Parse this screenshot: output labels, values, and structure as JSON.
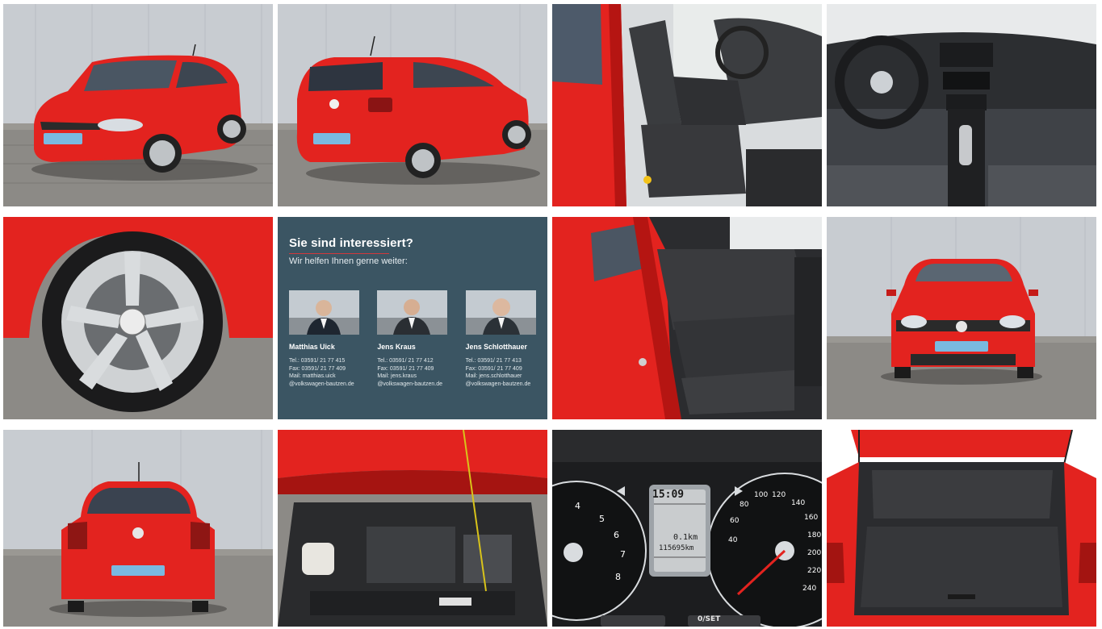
{
  "gallery": {
    "tiles": [
      {
        "id": "front-left-exterior"
      },
      {
        "id": "rear-right-exterior"
      },
      {
        "id": "front-seats-interior"
      },
      {
        "id": "dashboard-interior"
      },
      {
        "id": "wheel-rim"
      },
      {
        "id": "contact-card"
      },
      {
        "id": "rear-seats-interior"
      },
      {
        "id": "front-exterior"
      },
      {
        "id": "rear-exterior"
      },
      {
        "id": "engine-bay"
      },
      {
        "id": "instrument-cluster"
      },
      {
        "id": "trunk"
      }
    ]
  },
  "contact": {
    "title": "Sie sind interessiert?",
    "subtitle": "Wir helfen Ihnen gerne weiter:",
    "people": [
      {
        "name": "Matthias Uick",
        "tel": "Tel.:  03591/ 21 77 415",
        "fax": "Fax:  03591/ 21 77 409",
        "mail": "Mail:  matthias.uick",
        "domain": "@volkswagen-bautzen.de"
      },
      {
        "name": "Jens Kraus",
        "tel": "Tel.:   03591/ 21 77 412",
        "fax": "Fax:   03591/ 21 77 409",
        "mail": "Mail:   jens.kraus",
        "domain": "@volkswagen-bautzen.de"
      },
      {
        "name": "Jens Schlotthauer",
        "tel": "Tel.:  03591/ 21 77 413",
        "fax": "Fax:  03591/ 21 77 409",
        "mail": "Mail: jens.schlotthauer",
        "domain": "@volkswagen-bautzen.de"
      }
    ]
  },
  "cluster": {
    "clock": "15:09",
    "trip": "0.1km",
    "odometer": "115695km",
    "speed_ticks": [
      "40",
      "60",
      "80",
      "100",
      "120",
      "140",
      "160",
      "180",
      "200",
      "220",
      "240"
    ],
    "rpm_ticks": [
      "4",
      "5",
      "6",
      "7",
      "8"
    ],
    "buttons": [
      "0/SET"
    ]
  },
  "colors": {
    "car_red": "#e3231f",
    "contact_bg": "#3b5563",
    "accent_line": "#d2383b",
    "cobblestone": "#8c8a86",
    "wall": "#c8ccd1"
  }
}
